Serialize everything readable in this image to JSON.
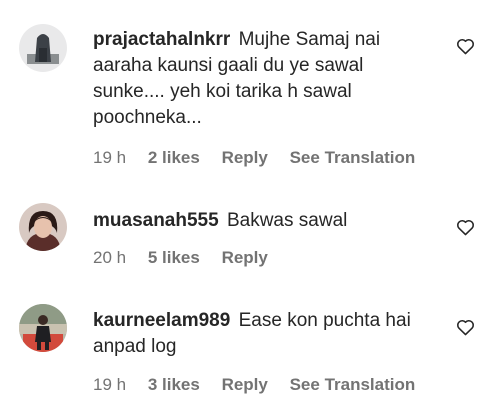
{
  "comments": [
    {
      "username": "prajactahalnkrr",
      "text": "Mujhe Samaj nai aaraha kaunsi gaali du ye sawal sunke.... yeh koi tarika h sawal poochneka...",
      "time": "19 h",
      "likes": "2 likes",
      "reply": "Reply",
      "translation": "See Translation"
    },
    {
      "username": "muasanah555",
      "text": "Bakwas sawal",
      "time": "20 h",
      "likes": "5 likes",
      "reply": "Reply"
    },
    {
      "username": "kaurneelam989",
      "text": "Ease kon puchta hai anpad log",
      "time": "19 h",
      "likes": "3 likes",
      "reply": "Reply",
      "translation": "See Translation"
    }
  ],
  "icons": {
    "like": "heart-outline-icon"
  }
}
